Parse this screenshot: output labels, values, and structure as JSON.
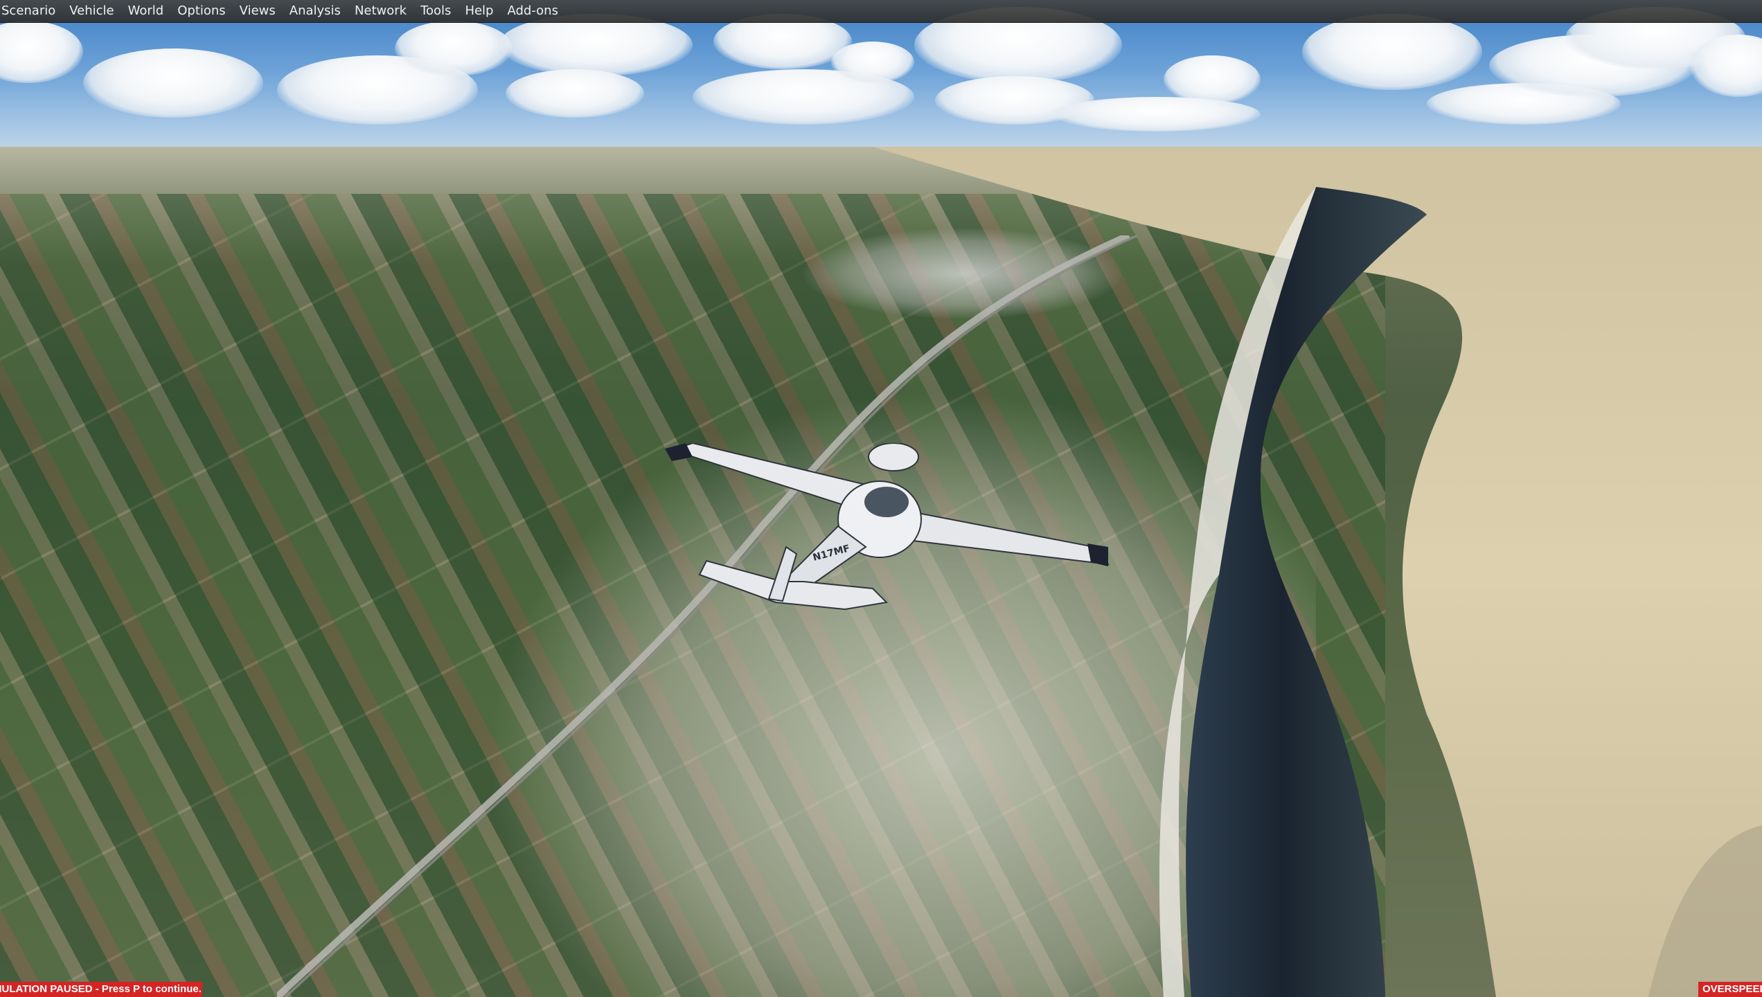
{
  "menu": {
    "items": [
      {
        "label": "Scenario"
      },
      {
        "label": "Vehicle"
      },
      {
        "label": "World"
      },
      {
        "label": "Options"
      },
      {
        "label": "Views"
      },
      {
        "label": "Analysis"
      },
      {
        "label": "Network"
      },
      {
        "label": "Tools"
      },
      {
        "label": "Help"
      },
      {
        "label": "Add-ons"
      }
    ]
  },
  "status": {
    "paused": "MULATION PAUSED - Press P to continue.",
    "overspeed": "OVERSPEED"
  },
  "colors": {
    "status_bg": "#d42424",
    "menubar_bg": "#3c3c3c",
    "sky_top": "#3f7fc4",
    "sea": "#1c2733",
    "desert": "#d8cba8"
  },
  "aircraft": {
    "registration": "N17MF"
  }
}
